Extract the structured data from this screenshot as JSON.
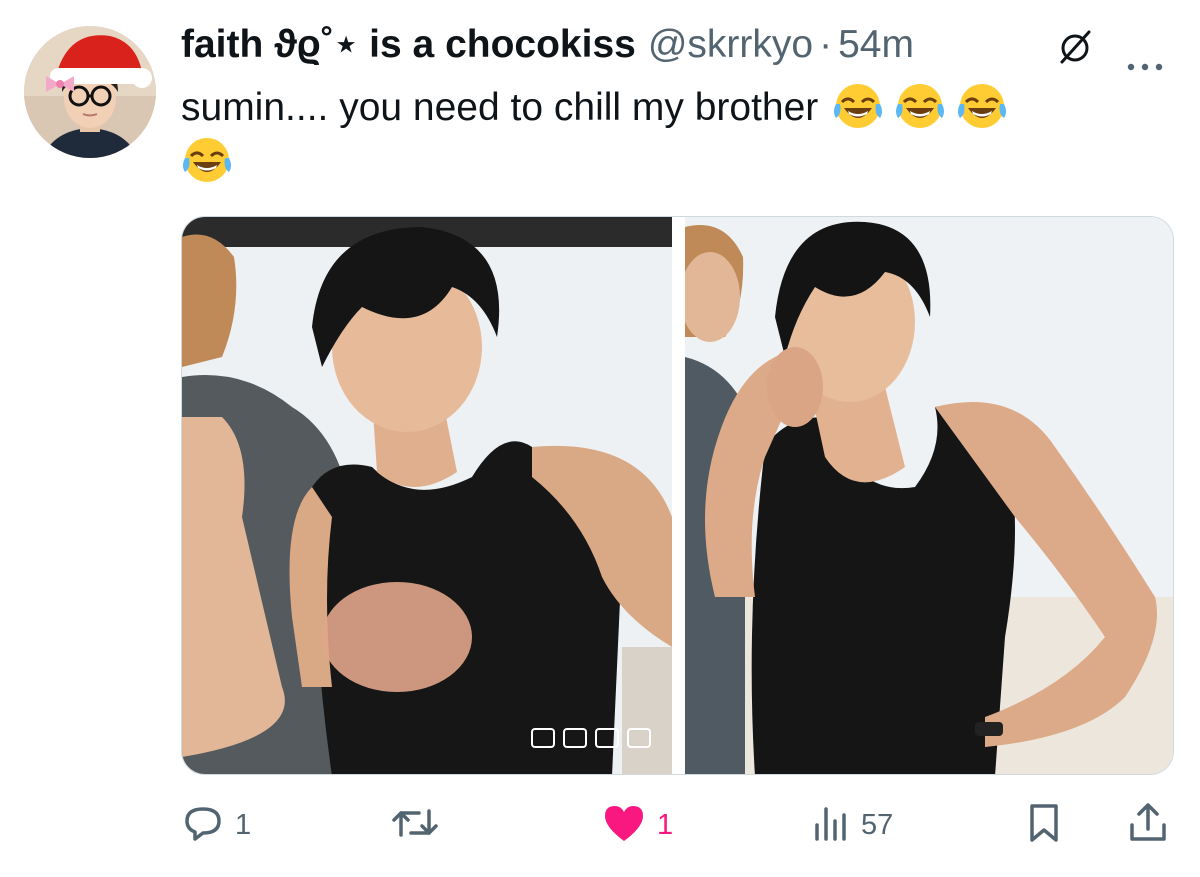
{
  "tweet": {
    "author": {
      "display_name": "faith ϑϱ˚⋆ is a chocokiss",
      "handle": "@skrrkyo",
      "avatar_icon": "profile-photo-santa-hat"
    },
    "separator": "·",
    "timestamp": "54m",
    "text": "sumin.... you need to chill my brother",
    "emojis": [
      "face-with-tears-of-joy",
      "face-with-tears-of-joy",
      "face-with-tears-of-joy",
      "face-with-tears-of-joy"
    ],
    "media": {
      "count": 2,
      "items": [
        {
          "icon": "photo-black-tank-top-pout"
        },
        {
          "icon": "photo-black-tank-top-hand-on-hip"
        }
      ]
    },
    "stats": {
      "replies": "1",
      "reposts": "",
      "likes": "1",
      "views": "57"
    },
    "liked": true,
    "colors": {
      "like_active": "#f91880",
      "secondary_text": "#536471",
      "primary_text": "#0f1419"
    }
  }
}
